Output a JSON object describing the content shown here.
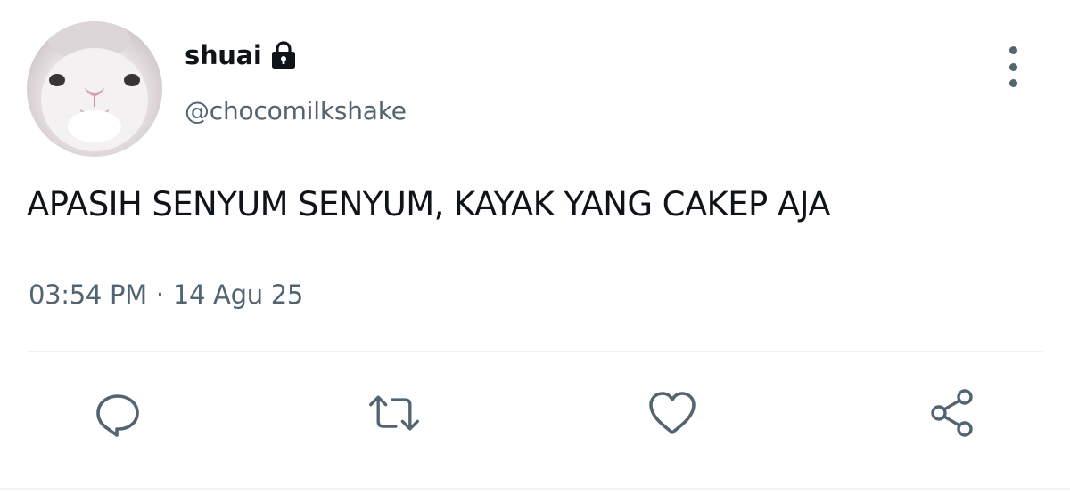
{
  "tweet": {
    "display_name": "shuai",
    "username": "@chocomilkshake",
    "text": "APASIH SENYUM SENYUM, KAYAK YANG CAKEP AJA",
    "time": "03:54 PM",
    "separator": "·",
    "date": "14 Agu 25",
    "protected": true
  },
  "icons": {
    "avatar": "rabbit-avatar",
    "lock": "lock-icon",
    "more": "more-vertical-icon",
    "reply": "reply-icon",
    "retweet": "retweet-icon",
    "like": "heart-icon",
    "share": "share-icon"
  },
  "colors": {
    "text_primary": "#0f1419",
    "text_secondary": "#536471",
    "divider": "#eff3f4",
    "background": "#ffffff"
  }
}
